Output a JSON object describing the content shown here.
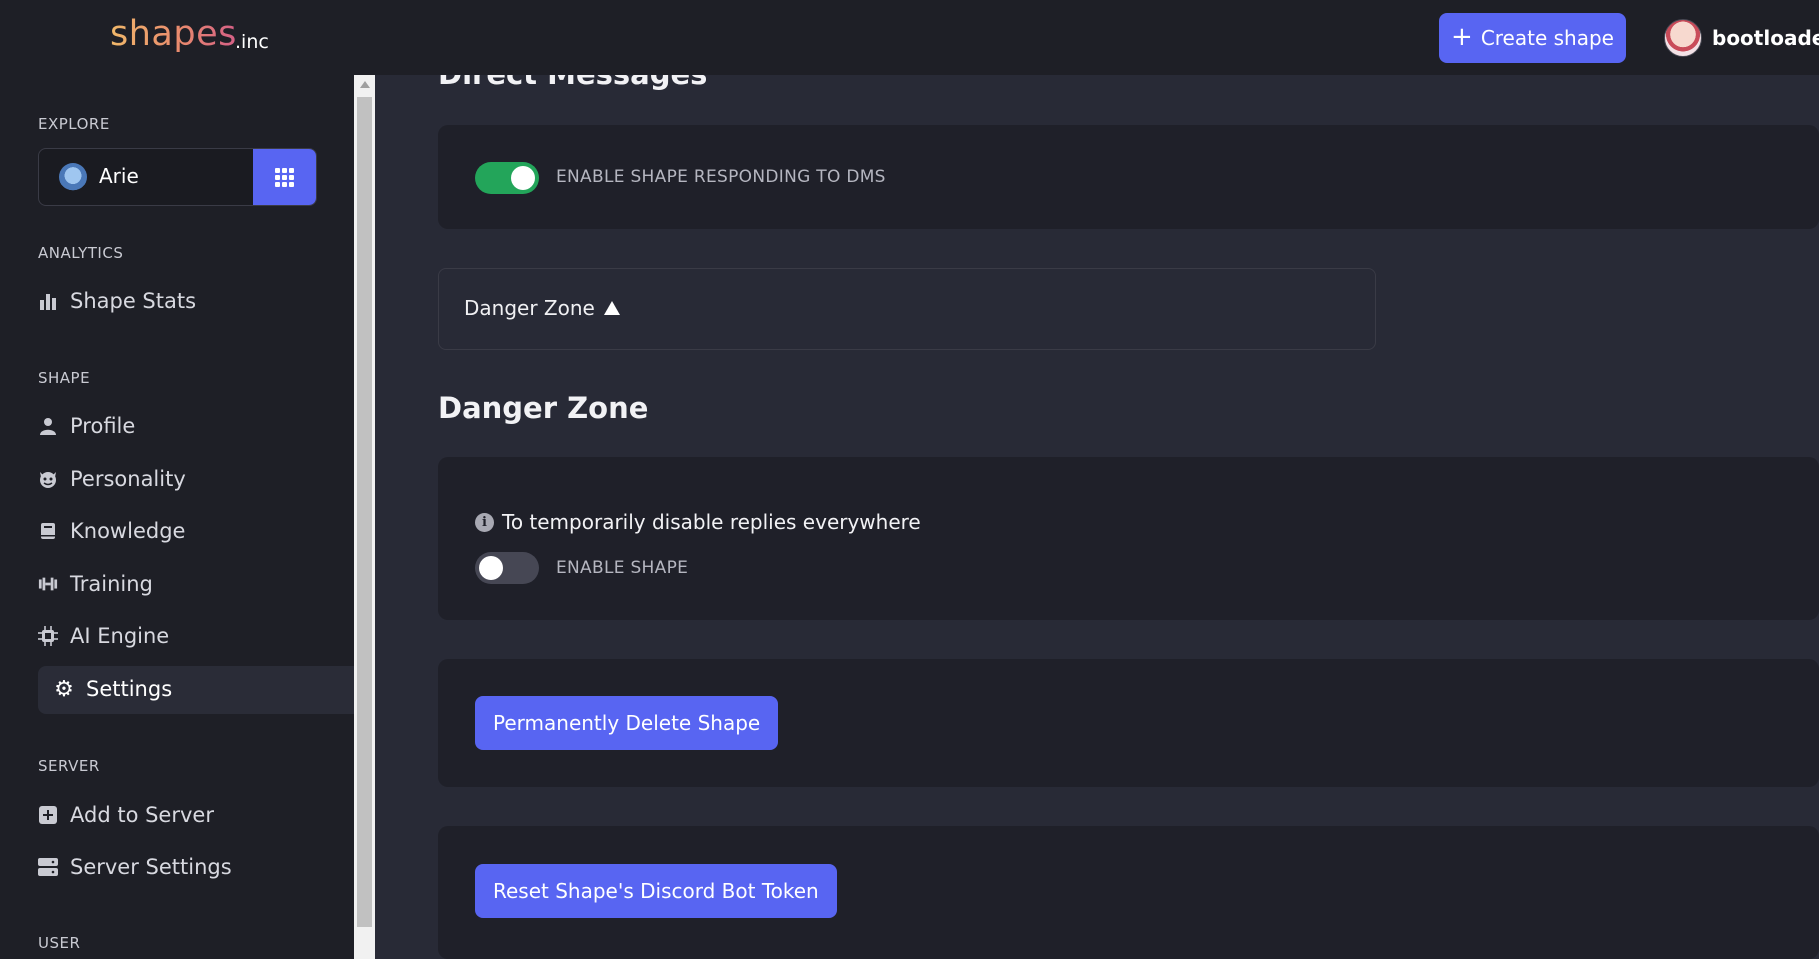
{
  "header": {
    "logo_text": "shapes",
    "logo_suffix": ".inc",
    "create_label": "Create shape",
    "user_name": "bootloader"
  },
  "sidebar": {
    "explore_label": "EXPLORE",
    "selected_shape": "Arie",
    "analytics_label": "ANALYTICS",
    "analytics_items": [
      {
        "label": "Shape Stats",
        "icon": "bar-chart-icon"
      }
    ],
    "shape_label": "SHAPE",
    "shape_items": [
      {
        "label": "Profile",
        "icon": "person-icon"
      },
      {
        "label": "Personality",
        "icon": "devil-face-icon"
      },
      {
        "label": "Knowledge",
        "icon": "book-icon"
      },
      {
        "label": "Training",
        "icon": "dumbbell-icon"
      },
      {
        "label": "AI Engine",
        "icon": "chip-icon"
      },
      {
        "label": "Settings",
        "icon": "gear-icon",
        "active": true
      }
    ],
    "server_label": "SERVER",
    "server_items": [
      {
        "label": "Add to Server",
        "icon": "plus-square-icon"
      },
      {
        "label": "Server Settings",
        "icon": "server-icon"
      }
    ],
    "user_label": "USER"
  },
  "main": {
    "dm_title": "Direct Messages",
    "dm_toggle_label": "ENABLE SHAPE RESPONDING TO DMS",
    "dm_toggle_on": true,
    "danger_collapse_label": "Danger Zone",
    "danger_title": "Danger Zone",
    "disable_info": "To temporarily disable replies everywhere",
    "enable_shape_label": "ENABLE SHAPE",
    "enable_shape_on": false,
    "delete_button": "Permanently Delete Shape",
    "reset_button": "Reset Shape's Discord Bot Token"
  },
  "colors": {
    "accent": "#5865f2",
    "toggle_on": "#23a55a",
    "background": "#282a36",
    "panel": "#1e1f26"
  }
}
